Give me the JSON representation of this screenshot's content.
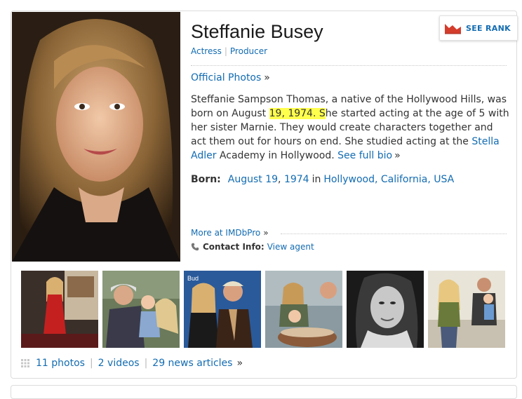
{
  "profile": {
    "name": "Steffanie Busey",
    "roles": [
      "Actress",
      "Producer"
    ],
    "see_rank_label": "SEE RANK",
    "official_photos_label": "Official Photos",
    "raquo": "»"
  },
  "bio": {
    "part1": "Steffanie Sampson Thomas, a native of the Hollywood Hills, was born on August ",
    "highlight": "19, 1974. S",
    "part2": "he started acting at the age of 5 with her sister Marnie. They would create characters together and act them out for hours on end. She studied acting at the ",
    "link_stella": "Stella Adler",
    "part3": " Academy in Hollywood. ",
    "see_full_bio": "See full bio"
  },
  "born": {
    "label": "Born:",
    "date_month": "August 19",
    "date_sep": ",",
    "date_year": "1974",
    "in_word": "in",
    "place": "Hollywood, California, USA"
  },
  "pro": {
    "more_label": "More at IMDbPro",
    "contact_label": "Contact Info:",
    "contact_link": "View agent"
  },
  "media": {
    "photos": "11 photos",
    "videos": "2 videos",
    "news": "29 news articles"
  },
  "colors": {
    "link": "#136cb2",
    "highlight": "#ffff4d",
    "rank_icon": "#d43c2c"
  },
  "icons": {
    "rank": "rank-chart-icon",
    "phone": "phone-icon",
    "grid": "grid-icon"
  }
}
